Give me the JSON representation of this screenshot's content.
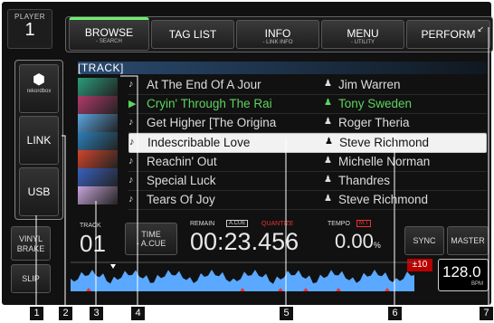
{
  "player": {
    "label": "PLAYER",
    "number": "1"
  },
  "tabs": [
    {
      "label": "BROWSE",
      "sub": "- SEARCH",
      "active": true
    },
    {
      "label": "TAG LIST",
      "sub": ""
    },
    {
      "label": "INFO",
      "sub": "- LINK INFO"
    },
    {
      "label": "MENU",
      "sub": "- UTILITY"
    },
    {
      "label": "PERFORM",
      "sub": ""
    }
  ],
  "sidebar": {
    "rekordbox_label": "rekordbox",
    "link_label": "LINK",
    "usb_label": "USB"
  },
  "browser": {
    "header": "[TRACK]",
    "rows": [
      {
        "title": "At The End Of A Jour",
        "artist": "Jim Warren",
        "state": "normal",
        "thumb_color": "#2a9c7a"
      },
      {
        "title": "Cryin' Through The Rai",
        "artist": "Tony Sweden",
        "state": "loaded",
        "thumb_color": "#b03a6a"
      },
      {
        "title": "Get Higher [The Origina",
        "artist": "Roger Theria",
        "state": "normal",
        "thumb_color": "#5aa6e0"
      },
      {
        "title": "Indescribable Love",
        "artist": "Steve Richmond",
        "state": "selected",
        "thumb_color": "#2c7fb8"
      },
      {
        "title": "Reachin' Out",
        "artist": "Michelle Norman",
        "state": "normal",
        "thumb_color": "#d0452b"
      },
      {
        "title": "Special Luck",
        "artist": "Thandres",
        "state": "normal",
        "thumb_color": "#3a60c0"
      },
      {
        "title": "Tears Of Joy",
        "artist": "Steve Richmond",
        "state": "normal",
        "thumb_color": "#c6a3d8"
      }
    ]
  },
  "deck": {
    "vinyl_brake": "VINYL BRAKE",
    "slip": "SLIP",
    "track_label": "TRACK",
    "track_number": "01",
    "time_label": "TIME",
    "acue_label": "- A.CUE",
    "remain_label": "REMAIN",
    "acue_tag": "A.CUE",
    "quantize_label": "QUANTIZE",
    "time_value": "00:23.456",
    "tempo_label": "TEMPO",
    "mt_tag": "M.T",
    "tempo_value": "0.00",
    "tempo_unit": "%",
    "sync": "SYNC",
    "master": "MASTER",
    "range": "±10",
    "bpm_value": "128.0",
    "bpm_unit": "BPM"
  },
  "callouts": [
    "1",
    "2",
    "3",
    "4",
    "5",
    "6",
    "7"
  ]
}
